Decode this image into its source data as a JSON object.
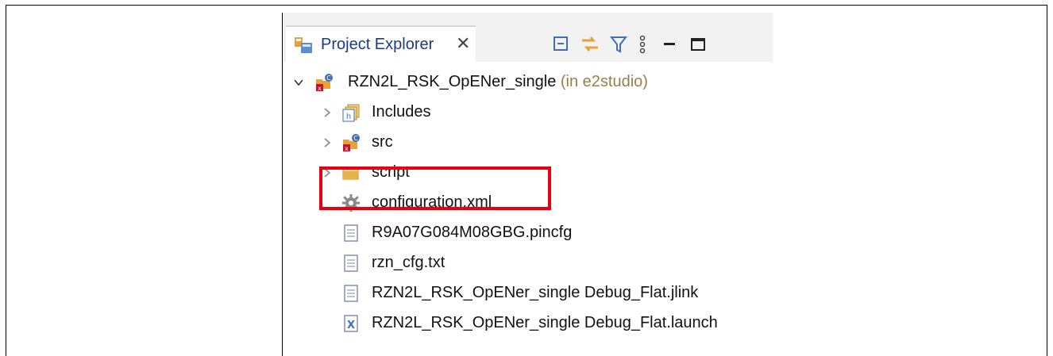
{
  "panel": {
    "title": "Project Explorer",
    "close_glyph": "✕"
  },
  "toolbar": [
    {
      "icon": "collapse-all-icon"
    },
    {
      "icon": "link-with-editor-icon"
    },
    {
      "icon": "filter-icon"
    },
    {
      "icon": "view-menu-icon"
    },
    {
      "icon": "minimize-icon"
    },
    {
      "icon": "maximize-icon"
    }
  ],
  "tree": {
    "project": {
      "name": "RZN2L_RSK_OpENer_single",
      "suffix": " (in e2studio)"
    },
    "children": [
      {
        "label": "Includes",
        "icon": "includes-folder-icon"
      },
      {
        "label": "src",
        "icon": "source-folder-icon"
      },
      {
        "label": "script",
        "icon": "folder-icon"
      },
      {
        "label": "configuration.xml",
        "icon": "gear-file-icon"
      },
      {
        "label": "R9A07G084M08GBG.pincfg",
        "icon": "text-file-icon"
      },
      {
        "label": "rzn_cfg.txt",
        "icon": "text-file-icon"
      },
      {
        "label": "RZN2L_RSK_OpENer_single Debug_Flat.jlink",
        "icon": "text-file-icon"
      },
      {
        "label": "RZN2L_RSK_OpENer_single Debug_Flat.launch",
        "icon": "launch-file-icon"
      }
    ]
  },
  "colors": {
    "highlight": "#e60012",
    "tab_text": "#1a3a8a",
    "suffix": "#9a7f4a"
  }
}
